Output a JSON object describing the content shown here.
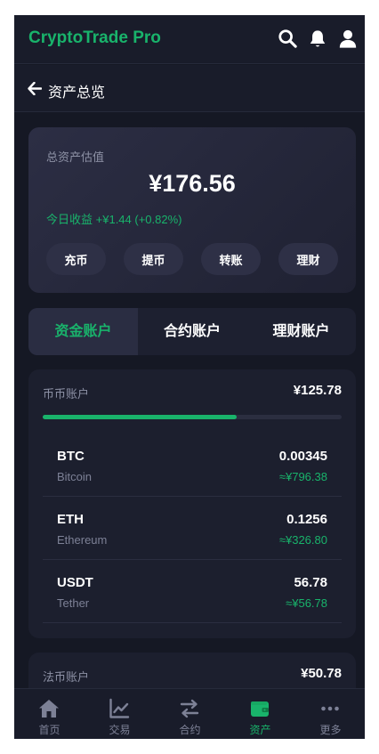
{
  "header": {
    "brand": "CryptoTrade Pro",
    "icons": [
      "search-icon",
      "bell-icon",
      "user-icon"
    ]
  },
  "subheader": {
    "back_icon": "arrow-left-icon",
    "title": "资产总览"
  },
  "summary": {
    "label": "总资产估值",
    "total": "¥176.56",
    "today_label": "今日收益",
    "today_change": "+¥1.44 (+0.82%)",
    "actions": [
      "充币",
      "提币",
      "转账",
      "理财"
    ]
  },
  "tabs": [
    "资金账户",
    "合约账户",
    "理财账户"
  ],
  "active_tab": 0,
  "accounts": [
    {
      "title": "币币账户",
      "total": "¥125.78",
      "share": 0.65,
      "coins": [
        {
          "symbol": "BTC",
          "name": "Bitcoin",
          "amount": "0.00345",
          "value": "≈¥796.38"
        },
        {
          "symbol": "ETH",
          "name": "Ethereum",
          "amount": "0.1256",
          "value": "≈¥326.80"
        },
        {
          "symbol": "USDT",
          "name": "Tether",
          "amount": "56.78",
          "value": "≈¥56.78"
        }
      ]
    },
    {
      "title": "法币账户",
      "total": "¥50.78"
    }
  ],
  "nav": [
    {
      "label": "首页",
      "icon": "home-icon"
    },
    {
      "label": "交易",
      "icon": "chart-line-icon"
    },
    {
      "label": "合约",
      "icon": "exchange-icon"
    },
    {
      "label": "资产",
      "icon": "wallet-icon"
    },
    {
      "label": "更多",
      "icon": "more-icon"
    }
  ],
  "active_nav": 3,
  "colors": {
    "accent": "#19b36b",
    "background": "#151824",
    "card": "#1c1f2e",
    "muted": "#8d91a5"
  }
}
